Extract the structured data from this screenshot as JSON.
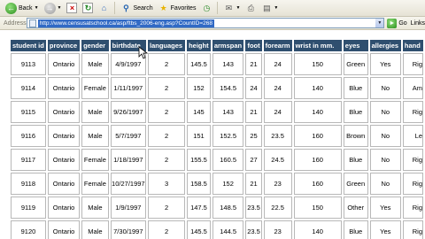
{
  "toolbar": {
    "back_label": "Back",
    "search_label": "Search",
    "favorites_label": "Favorites"
  },
  "address": {
    "label": "Address",
    "url": "http://www.censusatschool.ca/asp/ftbs_2006-eng.asp?CountID=268",
    "go_label": "Go",
    "links_label": "Links"
  },
  "table": {
    "headers": [
      "student id",
      "province",
      "gender",
      "birthdate",
      "languages",
      "height",
      "armspan",
      "foot",
      "forearm",
      "wrist in mm.",
      "eyes",
      "allergies",
      "hand"
    ],
    "rows": [
      [
        "9113",
        "Ontario",
        "Male",
        "4/9/1997",
        "2",
        "145.5",
        "143",
        "21",
        "24",
        "150",
        "Green",
        "Yes",
        "Rig"
      ],
      [
        "9114",
        "Ontario",
        "Female",
        "1/11/1997",
        "2",
        "152",
        "154.5",
        "24",
        "24",
        "140",
        "Blue",
        "No",
        "Am"
      ],
      [
        "9115",
        "Ontario",
        "Male",
        "9/26/1997",
        "2",
        "145",
        "143",
        "21",
        "24",
        "140",
        "Blue",
        "No",
        "Rig"
      ],
      [
        "9116",
        "Ontario",
        "Male",
        "5/7/1997",
        "2",
        "151",
        "152.5",
        "25",
        "23.5",
        "160",
        "Brown",
        "No",
        "Le"
      ],
      [
        "9117",
        "Ontario",
        "Female",
        "1/18/1997",
        "2",
        "155.5",
        "160.5",
        "27",
        "24.5",
        "160",
        "Blue",
        "No",
        "Rig"
      ],
      [
        "9118",
        "Ontario",
        "Female",
        "10/27/1997",
        "3",
        "158.5",
        "152",
        "21",
        "23",
        "160",
        "Green",
        "No",
        "Rig"
      ],
      [
        "9119",
        "Ontario",
        "Male",
        "1/9/1997",
        "2",
        "147.5",
        "148.5",
        "23.5",
        "22.5",
        "150",
        "Other",
        "Yes",
        "Rig"
      ],
      [
        "9120",
        "Ontario",
        "Male",
        "7/30/1997",
        "2",
        "145.5",
        "144.5",
        "23.5",
        "23",
        "140",
        "Blue",
        "Yes",
        "Rig"
      ]
    ]
  }
}
